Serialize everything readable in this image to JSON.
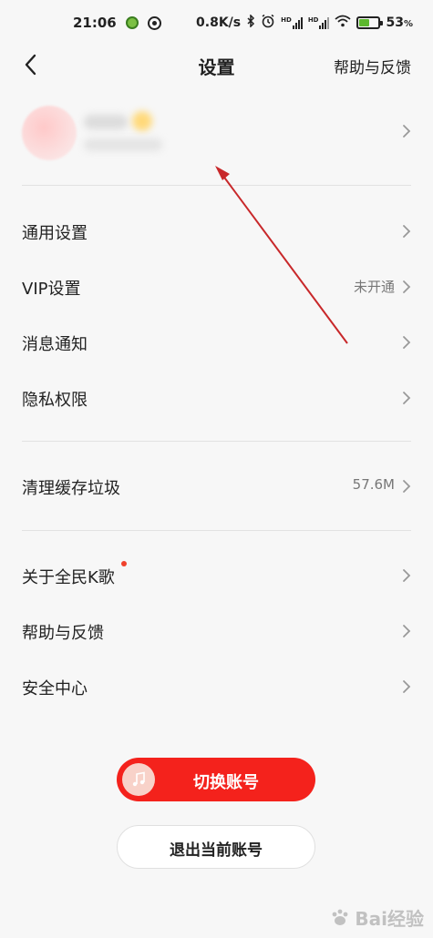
{
  "status_bar": {
    "time": "21:06",
    "net_speed": "0.8K/s",
    "hd_label": "HD",
    "battery_pct": "53",
    "battery_unit": "%",
    "battery_level": 0.53
  },
  "nav": {
    "title": "设置",
    "help_label": "帮助与反馈"
  },
  "sections": {
    "general": {
      "label": "通用设置"
    },
    "vip": {
      "label": "VIP设置",
      "value": "未开通"
    },
    "notify": {
      "label": "消息通知"
    },
    "privacy": {
      "label": "隐私权限"
    },
    "cache": {
      "label": "清理缓存垃圾",
      "value": "57.6M"
    },
    "about": {
      "label": "关于全民K歌"
    },
    "help": {
      "label": "帮助与反馈"
    },
    "security": {
      "label": "安全中心"
    }
  },
  "buttons": {
    "switch_account": "切换账号",
    "logout": "退出当前账号"
  },
  "watermark": {
    "text": "Bai经验"
  },
  "colors": {
    "accent_red": "#f4221c",
    "annotation_red": "#c8282a",
    "badge_red": "#f0412c"
  }
}
